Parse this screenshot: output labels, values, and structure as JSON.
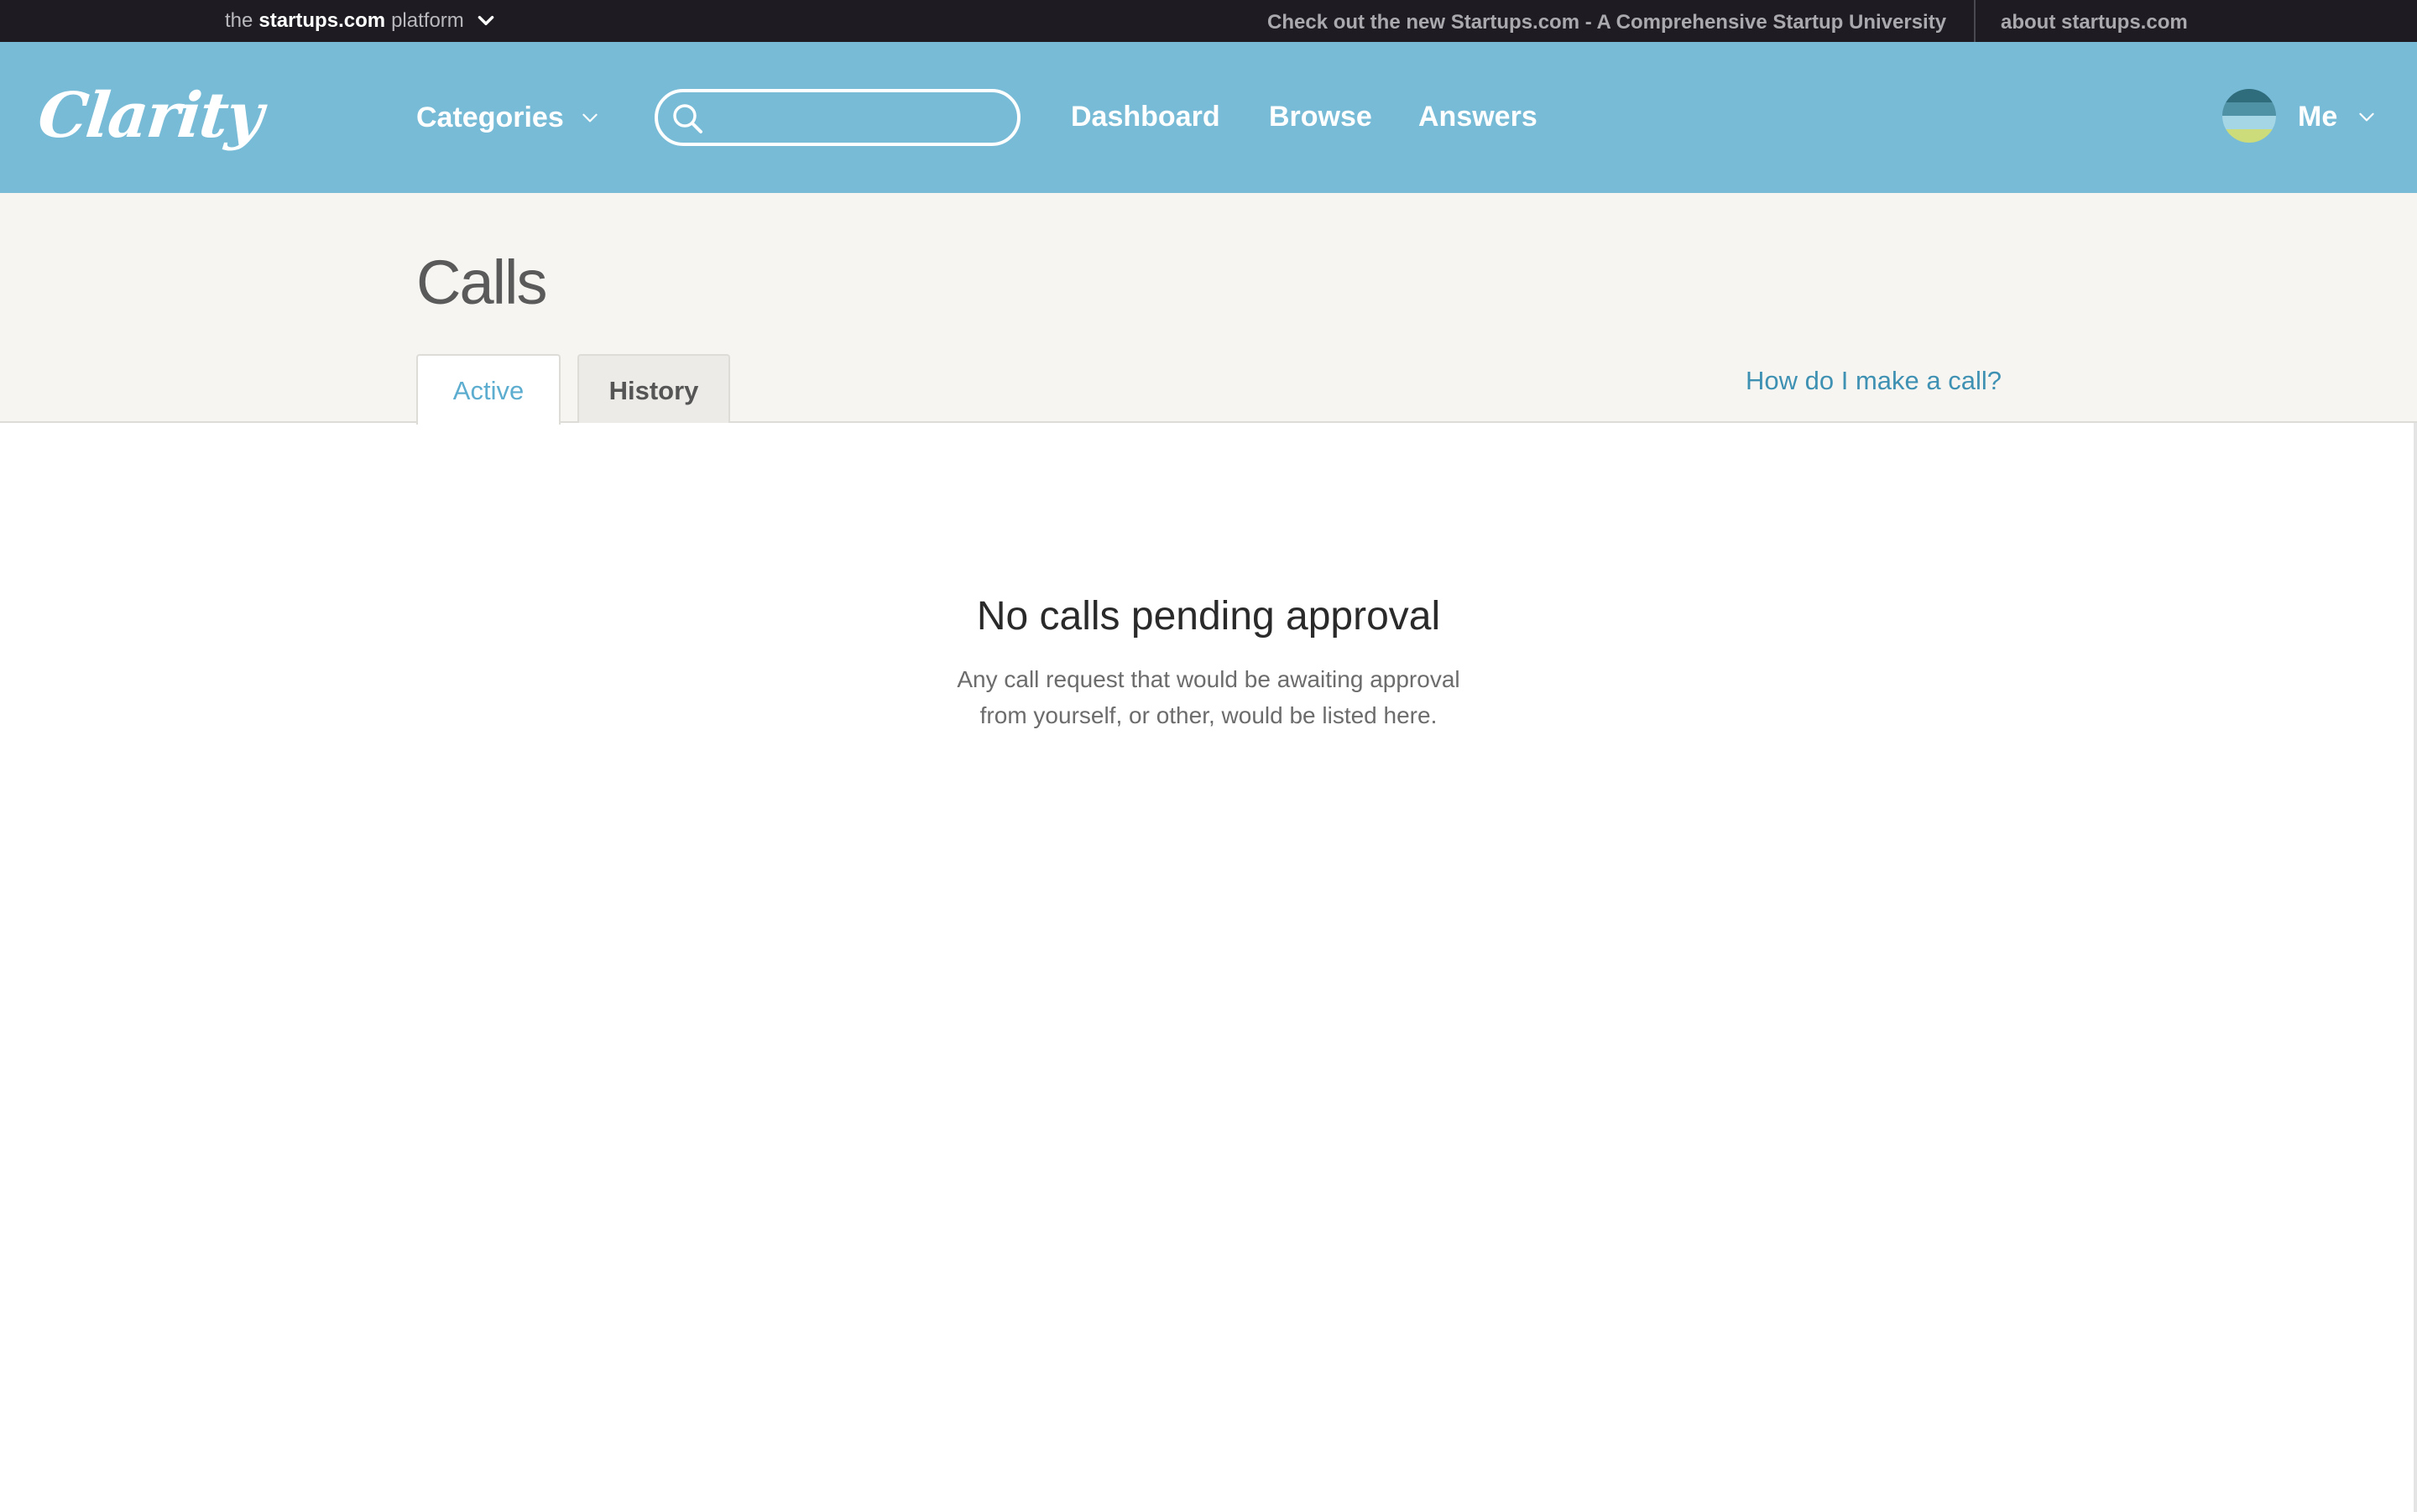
{
  "topbar": {
    "platform_prefix": "the",
    "platform_brand": "startups.com",
    "platform_suffix": "platform",
    "promo": "Check out the new Startups.com - A Comprehensive Startup University",
    "about": "about startups.com"
  },
  "header": {
    "logo": "Clarity",
    "categories_label": "Categories",
    "search": {
      "value": "",
      "placeholder": ""
    },
    "nav": {
      "dashboard": "Dashboard",
      "browse": "Browse",
      "answers": "Answers"
    },
    "user_label": "Me"
  },
  "page": {
    "title": "Calls",
    "tabs": [
      {
        "label": "Active",
        "selected": true
      },
      {
        "label": "History",
        "selected": false
      }
    ],
    "help_link": "How do I make a call?"
  },
  "empty_state": {
    "title": "No calls pending approval",
    "description_line1": "Any call request that would be awaiting approval",
    "description_line2": "from yourself, or other, would be listed here."
  },
  "colors": {
    "topbar_bg": "#1e1c22",
    "header_bg": "#78bbd6",
    "pagehead_bg": "#f6f5f1",
    "accent_link": "#3f91b3",
    "active_tab_text": "#5cadcf"
  },
  "icons": {
    "platform_dropdown": "chevron-down-icon",
    "categories_dropdown": "chevron-down-icon",
    "search": "search-icon",
    "user_dropdown": "chevron-down-icon"
  }
}
